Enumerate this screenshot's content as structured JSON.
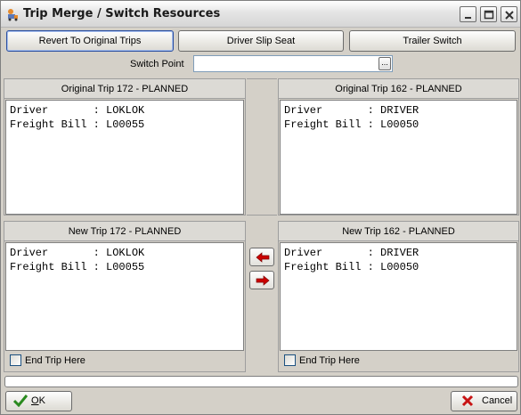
{
  "window": {
    "title": "Trip Merge / Switch Resources"
  },
  "toolbar": {
    "revert_label": "Revert To Original Trips",
    "slip_label": "Driver Slip Seat",
    "trailer_label": "Trailer Switch"
  },
  "switch_point": {
    "label": "Switch Point",
    "value": "",
    "lookup_label": "..."
  },
  "panels": {
    "orig_left": {
      "title": "Original Trip 172 - PLANNED",
      "text": "Driver       : LOKLOK\nFreight Bill : L00055"
    },
    "orig_right": {
      "title": "Original Trip 162 - PLANNED",
      "text": "Driver       : DRIVER\nFreight Bill : L00050"
    },
    "new_left": {
      "title": "New Trip 172 - PLANNED",
      "text": "Driver       : LOKLOK\nFreight Bill : L00055",
      "end_trip_label": "End Trip Here"
    },
    "new_right": {
      "title": "New Trip 162 - PLANNED",
      "text": "Driver       : DRIVER\nFreight Bill : L00050",
      "end_trip_label": "End Trip Here"
    }
  },
  "icons": {
    "app": "truck-icon",
    "move_left": "arrow-left-icon",
    "move_right": "arrow-right-icon",
    "ok": "check-icon",
    "cancel": "x-icon"
  },
  "colors": {
    "arrow": "#cc0000",
    "ok_check": "#2a8a1f",
    "cancel_x": "#c81414"
  },
  "footer": {
    "ok_label": "OK",
    "ok_rest": "K",
    "cancel_label": "Cancel"
  }
}
